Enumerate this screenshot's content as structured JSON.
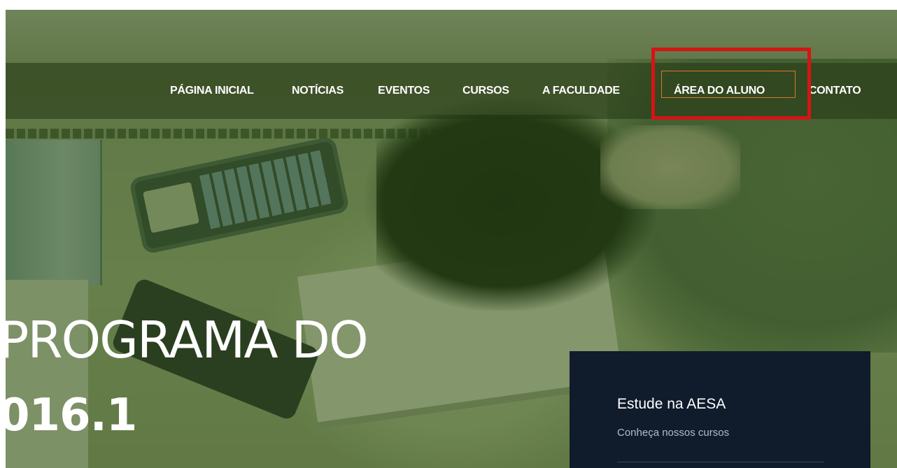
{
  "nav": {
    "items": [
      {
        "label": "PÁGINA INICIAL"
      },
      {
        "label": "NOTÍCIAS"
      },
      {
        "label": "EVENTOS"
      },
      {
        "label": "CURSOS"
      },
      {
        "label": "A FACULDADE"
      },
      {
        "label": "ÁREA DO ALUNO",
        "active": true
      },
      {
        "label": "CONTATO"
      }
    ],
    "active_border_color": "#d9772a",
    "highlight_color": "#d61414"
  },
  "hero": {
    "title": "PROGRAMA DO",
    "subtitle": "016.1"
  },
  "card": {
    "title": "Estude na AESA",
    "link": "Conheça nossos cursos",
    "background": "#101b2c"
  }
}
